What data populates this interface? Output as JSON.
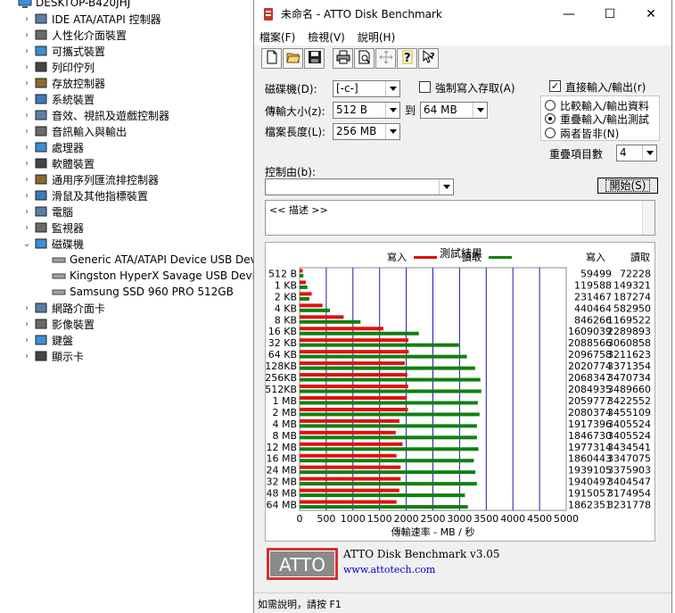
{
  "devmgr": {
    "root": "DESKTOP-B420JHJ",
    "items": [
      {
        "label": "IDE ATA/ATAPI 控制器",
        "icon": "ide-controller-icon"
      },
      {
        "label": "人性化介面裝置",
        "icon": "hid-icon"
      },
      {
        "label": "可攜式裝置",
        "icon": "portable-device-icon"
      },
      {
        "label": "列印佇列",
        "icon": "printer-icon"
      },
      {
        "label": "存放控制器",
        "icon": "storage-controller-icon"
      },
      {
        "label": "系統裝置",
        "icon": "system-device-icon"
      },
      {
        "label": "音效、視訊及遊戲控制器",
        "icon": "sound-icon"
      },
      {
        "label": "音訊輸入與輸出",
        "icon": "audio-io-icon"
      },
      {
        "label": "處理器",
        "icon": "processor-icon"
      },
      {
        "label": "軟體裝置",
        "icon": "software-device-icon"
      },
      {
        "label": "通用序列匯流排控制器",
        "icon": "usb-icon"
      },
      {
        "label": "滑鼠及其他指標裝置",
        "icon": "mouse-icon"
      },
      {
        "label": "電腦",
        "icon": "computer-icon"
      },
      {
        "label": "監視器",
        "icon": "monitor-icon"
      },
      {
        "label": "磁碟機",
        "icon": "disk-drive-icon"
      },
      {
        "label": "Generic ATA/ATAPI Device USB Device",
        "icon": "disk-icon"
      },
      {
        "label": "Kingston HyperX Savage USB Device",
        "icon": "disk-icon"
      },
      {
        "label": "Samsung SSD 960 PRO 512GB",
        "icon": "disk-icon"
      },
      {
        "label": "網路介面卡",
        "icon": "network-icon"
      },
      {
        "label": "影像裝置",
        "icon": "imaging-icon"
      },
      {
        "label": "鍵盤",
        "icon": "keyboard-icon"
      },
      {
        "label": "顯示卡",
        "icon": "display-adapter-icon"
      }
    ]
  },
  "window": {
    "title": "未命名 - ATTO Disk Benchmark",
    "min": "—",
    "max": "☐",
    "close": "✕"
  },
  "menu": [
    "檔案(F)",
    "檢視(V)",
    "說明(H)"
  ],
  "form": {
    "drive_label": "磁碟機(D):",
    "drive_value": "[-c-]",
    "force_write_label": "強制寫入存取(A)",
    "direct_io_label": "直接輸入/輸出(r)",
    "direct_io_checked": "✓",
    "transfer_label": "傳輸大小(z):",
    "transfer_from": "512 B",
    "transfer_to_label": "到",
    "transfer_to": "64 MB",
    "length_label": "檔案長度(L):",
    "length_value": "256 MB",
    "radio_compare": "比較輸入/輸出資料",
    "radio_overlap": "重疊輸入/輸出測試",
    "radio_neither": "兩者皆非(N)",
    "queue_label": "重疊項目數",
    "queue_value": "4",
    "controlled_label": "控制由(b):",
    "controlled_value": "",
    "start_label": "開始(S)",
    "desc_text": "<< 描述 >>"
  },
  "chart_data": {
    "type": "bar",
    "orientation": "horizontal",
    "title": "測試結果",
    "legend_write": "寫入",
    "legend_read": "讀取",
    "col_write": "寫入",
    "col_read": "讀取",
    "xlabel": "傳輸速率 - MB / 秒",
    "xlim": [
      0,
      5000
    ],
    "xticks": [
      "0",
      "500",
      "1000",
      "1500",
      "2000",
      "2500",
      "3000",
      "3500",
      "4000",
      "4500",
      "5000"
    ],
    "categories": [
      "512 B",
      "1 KB",
      "2 KB",
      "4 KB",
      "8 KB",
      "16 KB",
      "32 KB",
      "64 KB",
      "128KB",
      "256KB",
      "512KB",
      "1 MB",
      "2 MB",
      "4 MB",
      "8 MB",
      "12 MB",
      "16 MB",
      "24 MB",
      "32 MB",
      "48 MB",
      "64 MB"
    ],
    "write_kb": [
      59499,
      119588,
      231467,
      440464,
      846266,
      1609039,
      2088566,
      2096758,
      2020774,
      2068347,
      2084935,
      2059777,
      2080374,
      1917396,
      1846730,
      1977314,
      1860443,
      1939105,
      1940497,
      1915057,
      1862351
    ],
    "read_kb": [
      72228,
      149321,
      187274,
      582950,
      1169522,
      2289893,
      3060858,
      3211623,
      3371354,
      3470734,
      3489660,
      3422552,
      3455109,
      3405524,
      3405524,
      3434541,
      3347075,
      3375903,
      3404547,
      3174954,
      3231778
    ],
    "write_color": "#e01010",
    "read_color": "#108010",
    "grid_color": "#1c1ca8"
  },
  "footer": {
    "logo_text": "ATTO",
    "version": "ATTO Disk Benchmark v3.05",
    "url": "www.attotech.com"
  },
  "status": "如需說明，請按 F1"
}
